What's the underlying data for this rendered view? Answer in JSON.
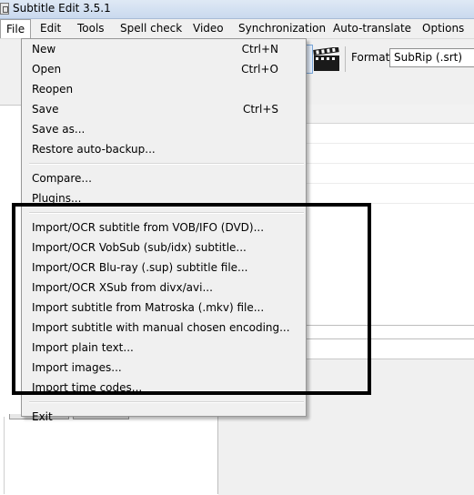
{
  "window": {
    "title": "Subtitle Edit 3.5.1",
    "icon": "app-icon"
  },
  "menubar": {
    "items": [
      "File",
      "Edit",
      "Tools",
      "Spell check",
      "Video",
      "Synchronization",
      "Auto-translate",
      "Options"
    ],
    "active": "File"
  },
  "toolbar": {
    "format_label": "Format",
    "format_value": "SubRip (.srt)",
    "video_icon": "clapperboard-icon"
  },
  "file_menu": {
    "groups": [
      [
        {
          "label": "New",
          "shortcut": "Ctrl+N"
        },
        {
          "label": "Open",
          "shortcut": "Ctrl+O"
        },
        {
          "label": "Reopen",
          "shortcut": ""
        },
        {
          "label": "Save",
          "shortcut": "Ctrl+S"
        },
        {
          "label": "Save as...",
          "shortcut": ""
        },
        {
          "label": "Restore auto-backup...",
          "shortcut": ""
        }
      ],
      [
        {
          "label": "Compare...",
          "shortcut": ""
        },
        {
          "label": "Plugins...",
          "shortcut": ""
        }
      ],
      [
        {
          "label": "Import/OCR subtitle from VOB/IFO (DVD)...",
          "shortcut": ""
        },
        {
          "label": "Import/OCR VobSub (sub/idx) subtitle...",
          "shortcut": ""
        },
        {
          "label": "Import/OCR Blu-ray (.sup) subtitle file...",
          "shortcut": ""
        },
        {
          "label": "Import/OCR XSub from divx/avi...",
          "shortcut": ""
        },
        {
          "label": "Import subtitle from Matroska (.mkv) file...",
          "shortcut": ""
        },
        {
          "label": "Import subtitle with manual chosen encoding...",
          "shortcut": ""
        },
        {
          "label": "Import plain text...",
          "shortcut": ""
        },
        {
          "label": "Import images...",
          "shortcut": ""
        },
        {
          "label": "Import time codes...",
          "shortcut": ""
        }
      ],
      [
        {
          "label": "Exit",
          "shortcut": ""
        }
      ]
    ]
  },
  "highlight": {
    "color": "#000000",
    "covers_group": 2
  }
}
